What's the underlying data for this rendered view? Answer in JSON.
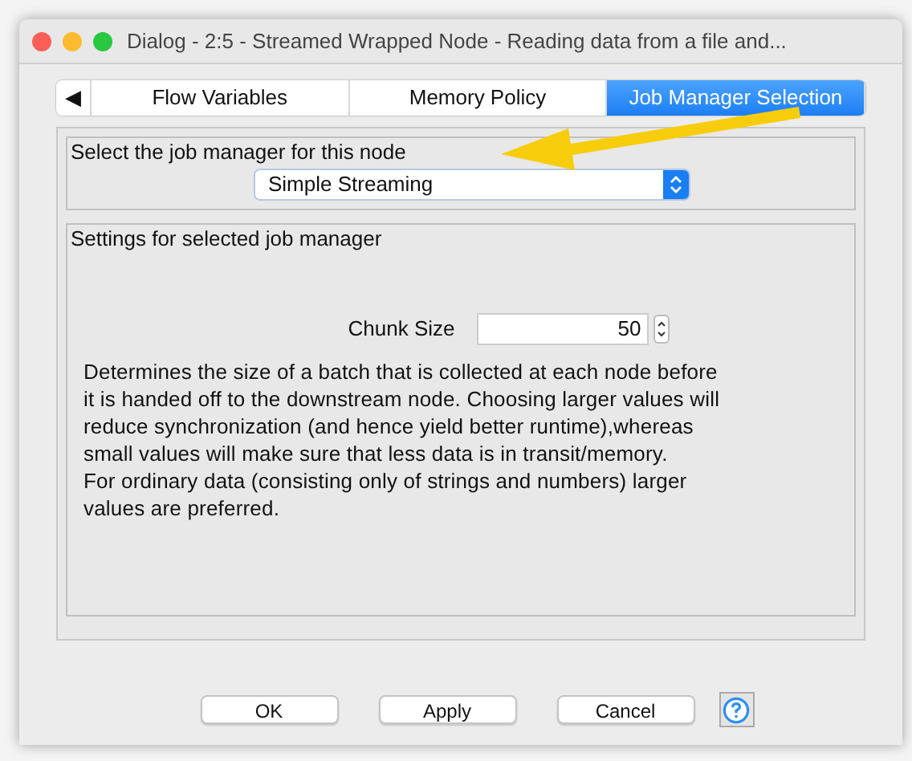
{
  "window": {
    "title": "Dialog - 2:5 - Streamed Wrapped Node - Reading data from a file and..."
  },
  "tabs": [
    {
      "label": "◀",
      "selected": false
    },
    {
      "label": "Flow Variables",
      "selected": false
    },
    {
      "label": "Memory Policy",
      "selected": false
    },
    {
      "label": "Job Manager Selection",
      "selected": true
    }
  ],
  "job_manager_group": {
    "title": "Select the job manager for this node",
    "value": "Simple Streaming"
  },
  "settings_group": {
    "title": "Settings for selected job manager",
    "chunk_size": {
      "label": "Chunk Size",
      "value": "50"
    },
    "description": [
      "Determines the size of a batch that is collected at each node before",
      "it is handed off to the downstream node. Choosing larger values will",
      "reduce synchronization (and hence yield better runtime),whereas",
      "small values will make sure that less data is in transit/memory.",
      "For ordinary data (consisting only of strings and numbers) larger",
      "values are preferred."
    ]
  },
  "buttons": [
    "OK",
    "Apply",
    "Cancel"
  ]
}
